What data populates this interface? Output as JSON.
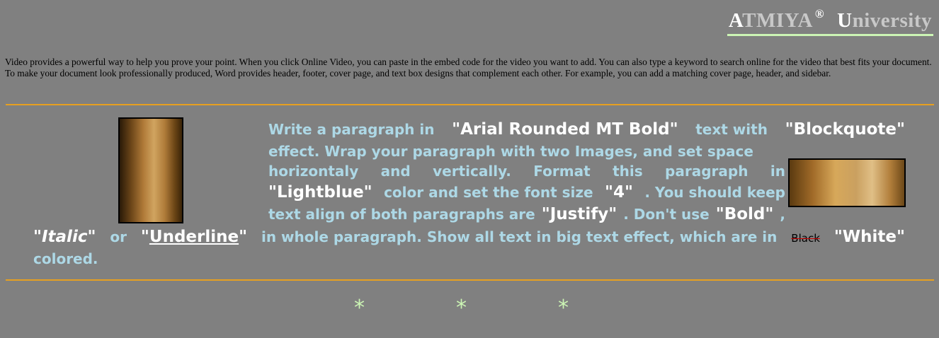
{
  "header": {
    "a_cap": "A",
    "a_rest": "TMIYA",
    "reg": "®",
    "u_cap": "U",
    "u_rest": "niversity"
  },
  "intro": "Video provides a powerful way to help you prove your point. When you click Online Video, you can paste in the embed code for the video you want to add. You can also type a keyword to search online for the video that best fits your document. To make your document look professionally produced, Word provides header, footer, cover page, and text box designs that complement each other. For example, you can add a matching cover page, header, and sidebar.",
  "quote": {
    "l1": [
      "Write a paragraph in",
      "\"Arial Rounded MT Bold\"",
      "text with",
      "\"Blockquote\""
    ],
    "l2": "effect. Wrap your paragraph with two Images, and set space",
    "l3": [
      "horizontaly",
      "and",
      "vertically.",
      "Format",
      "this",
      "paragraph",
      "in"
    ],
    "l4": [
      "\"Lightblue\"",
      "color and set the font size",
      "\"4\"",
      ". You should keep"
    ],
    "l5": [
      "text align of both paragraphs are",
      "\"Justify\"",
      ". Don't use",
      "\"Bold\"",
      ","
    ],
    "l6": [
      "\"",
      "Italic",
      "\"",
      "or",
      "\"",
      "Underline",
      "\"",
      "in whole paragraph. Show all text in big text effect, which are in",
      "Black",
      "\"White\""
    ],
    "l7": "colored."
  },
  "stars": [
    "*",
    "*",
    "*"
  ]
}
